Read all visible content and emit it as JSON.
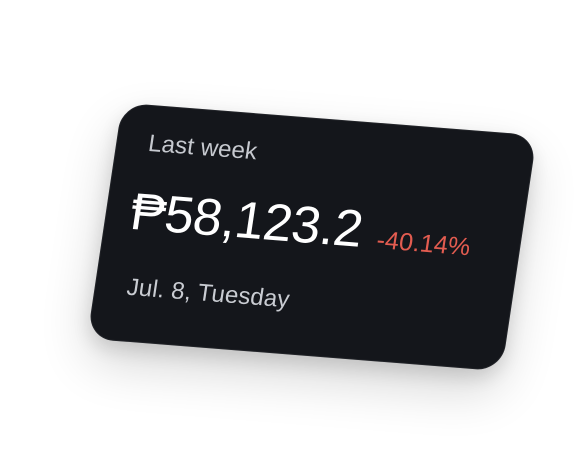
{
  "card": {
    "period_label": "Last week",
    "amount": "₱58,123.2",
    "change": "-40.14%",
    "date": "Jul. 8, Tuesday"
  },
  "colors": {
    "card_background": "#14161b",
    "primary_text": "#ffffff",
    "secondary_text": "#c6c9cf",
    "negative_change": "#e35c50",
    "page_background": "#ffffff"
  }
}
